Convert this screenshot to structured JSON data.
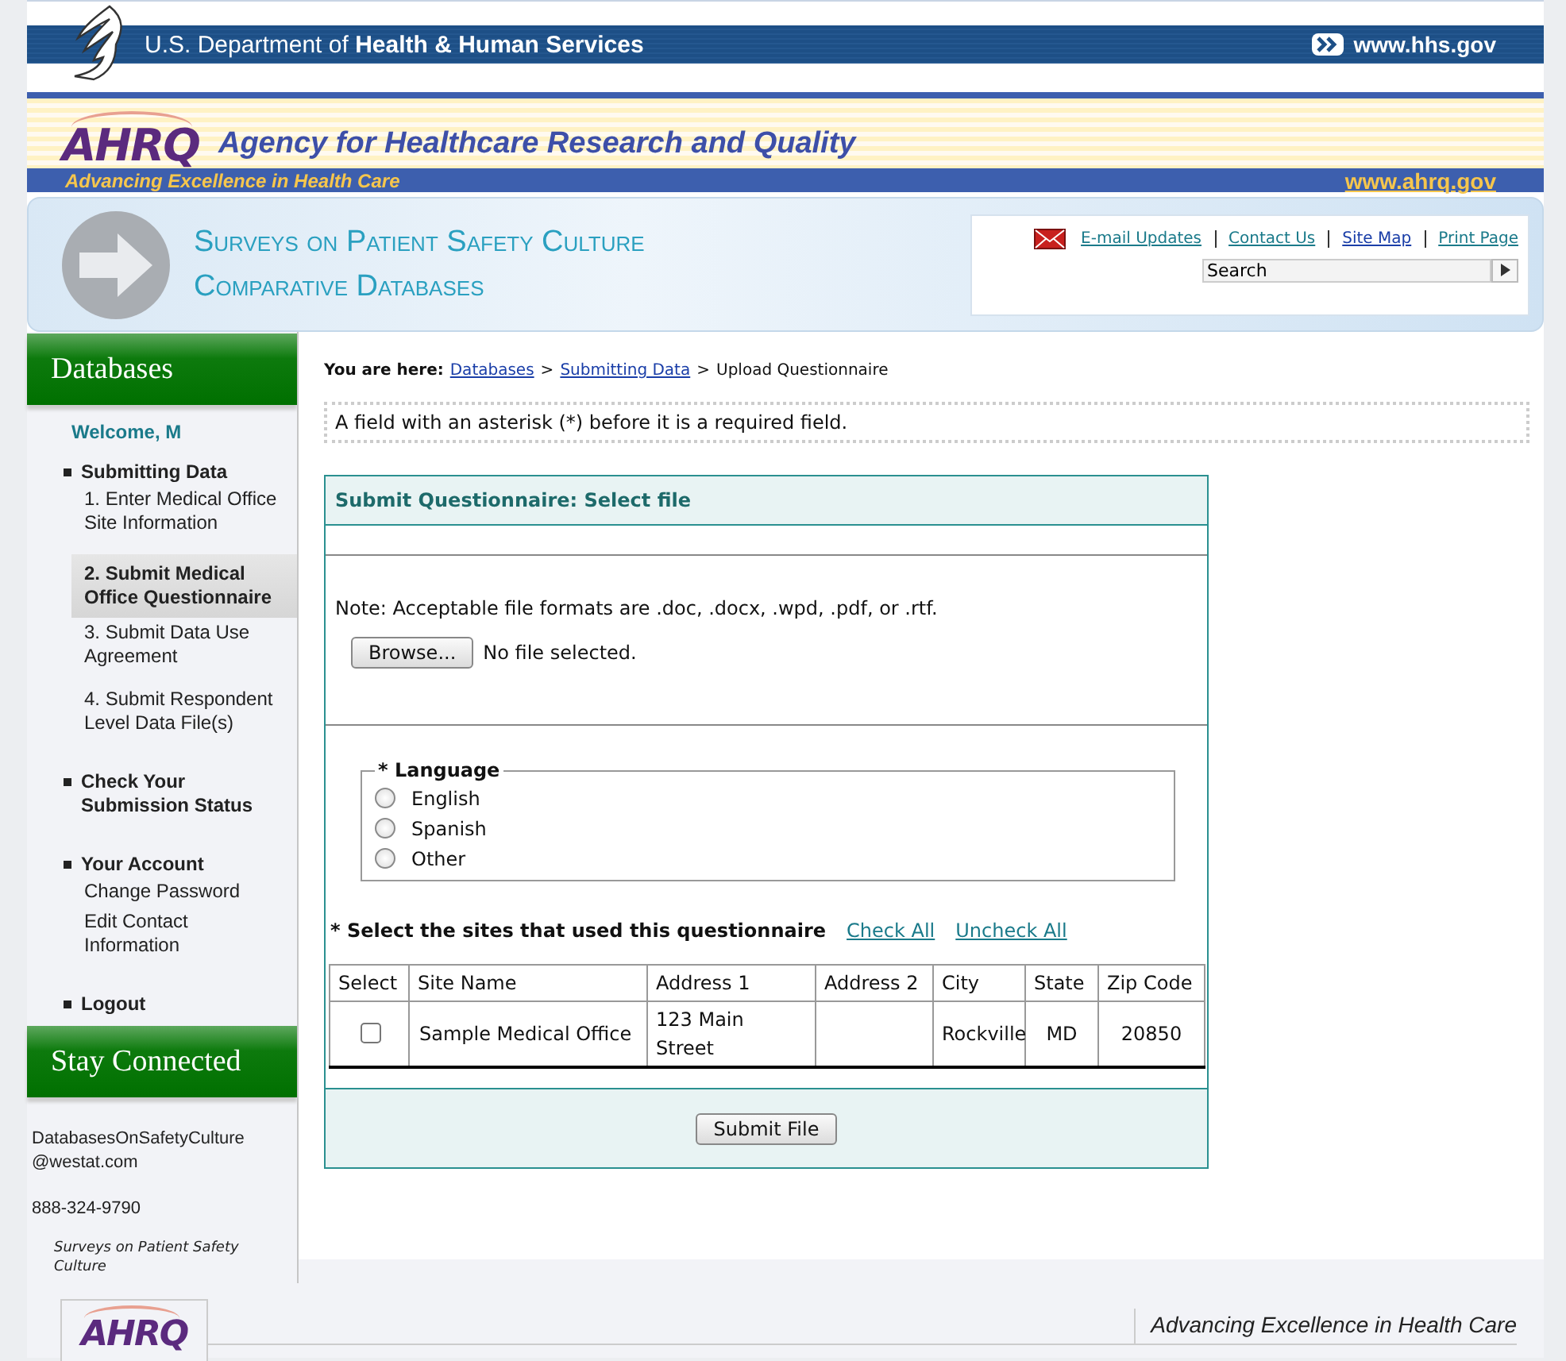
{
  "hhs_bar": {
    "title": "U.S. Department of **Health & Human Services**",
    "link": "www.hhs.gov"
  },
  "agency_banner": {
    "logo": "AHRQ",
    "name": "Agency for Healthcare Research and Quality",
    "tagline": "Advancing Excellence in Health Care",
    "link": "www.ahrq.gov"
  },
  "site_banner": {
    "title_lines": [
      "Surveys on Patient Safety Culture",
      "Comparative Databases"
    ],
    "links": [
      "E-mail Updates",
      "Contact Us",
      "Site Map",
      "Print Page"
    ],
    "search": {
      "value": "Search"
    }
  },
  "sidebar": {
    "heading": "Databases",
    "welcome": "Welcome, M",
    "sections": [
      {
        "label": "Submitting Data",
        "items": [
          {
            "label": "1. Enter Medical Office Site Information",
            "selected": false
          },
          {
            "label": "2. Submit Medical Office Questionnaire",
            "selected": true
          },
          {
            "label": "3. Submit Data Use Agreement",
            "selected": false
          },
          {
            "label": "4. Submit Respondent Level Data File(s)",
            "selected": false
          }
        ]
      },
      {
        "label": "Check Your Submission Status"
      },
      {
        "label": "Your Account",
        "items": [
          {
            "label": "Change Password",
            "selected": false
          },
          {
            "label": "Edit Contact Information",
            "selected": false
          }
        ]
      },
      {
        "label": "Logout"
      }
    ],
    "stay_connected": {
      "heading": "Stay Connected",
      "email": "DatabasesOnSafetyCulture@westat.com",
      "phone": "888-324-9790",
      "caption": "Surveys on Patient Safety Culture"
    }
  },
  "breadcrumb": {
    "label": "You are here:",
    "crumbs": [
      {
        "kind": "link",
        "text": "Databases"
      },
      {
        "kind": "separator",
        "text": ">"
      },
      {
        "kind": "link",
        "text": "Submitting Data"
      },
      {
        "kind": "separator",
        "text": ">"
      },
      {
        "kind": "current",
        "text": "Upload Questionnaire"
      }
    ]
  },
  "required_note": "A field with an asterisk (*) before it is a required field.",
  "form": {
    "title": "Submit Questionnaire: Select file",
    "note": "Note: Acceptable file formats are .doc, .docx, .wpd, .pdf, or .rtf.",
    "browse_button": "Browse...",
    "file_status": "No file selected.",
    "language": {
      "legend": "* Language",
      "options": [
        {
          "label": "English",
          "selected": false
        },
        {
          "label": "Spanish",
          "selected": false
        },
        {
          "label": "Other",
          "selected": false
        }
      ]
    },
    "sites": {
      "prompt": "* Select the sites that used this questionnaire",
      "links": [
        "Check All",
        "Uncheck All"
      ],
      "columns": [
        "Select",
        "Site Name",
        "Address 1",
        "Address 2",
        "City",
        "State",
        "Zip Code"
      ],
      "rows": [
        {
          "checked": false,
          "site_name": "Sample Medical Office",
          "address_1": "123 Main Street",
          "city": "Rockville",
          "state": "MD",
          "zip_code": "20850"
        }
      ]
    },
    "submit_button": "Submit File"
  },
  "footer": {
    "logo": "AHRQ",
    "tagline": "Advancing Excellence in Health Care"
  }
}
